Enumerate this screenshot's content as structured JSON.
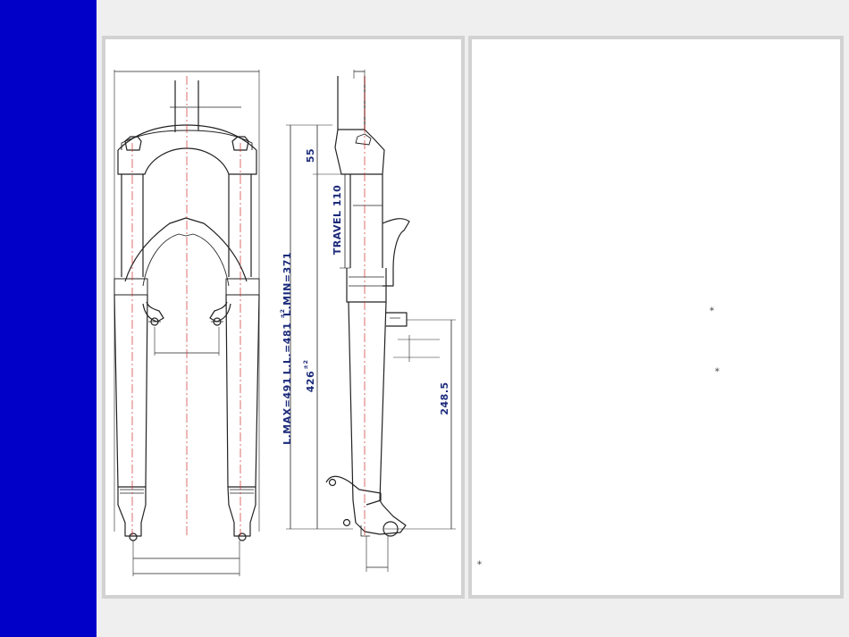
{
  "colors": {
    "sidebar": "#0000c8",
    "background": "#efefef",
    "panel_border": "#d2d2d2",
    "outline": "#222222",
    "centerline": "#d03030",
    "dimension_text": "#1b2a7a"
  },
  "dimensions": {
    "height_55": "55",
    "travel": "TRAVEL 110",
    "l_min": "L.MIN=371",
    "l_l": "L.L.=481",
    "l_l_tol": "±2",
    "l_max": "L.MAX=491",
    "val_426": "426",
    "val_426_tol": "±2",
    "val_248": "248.5"
  },
  "notes": {
    "marker_1": "*",
    "marker_2": "*",
    "marker_3": "*"
  },
  "icons": {
    "note_marker": "asterisk"
  }
}
